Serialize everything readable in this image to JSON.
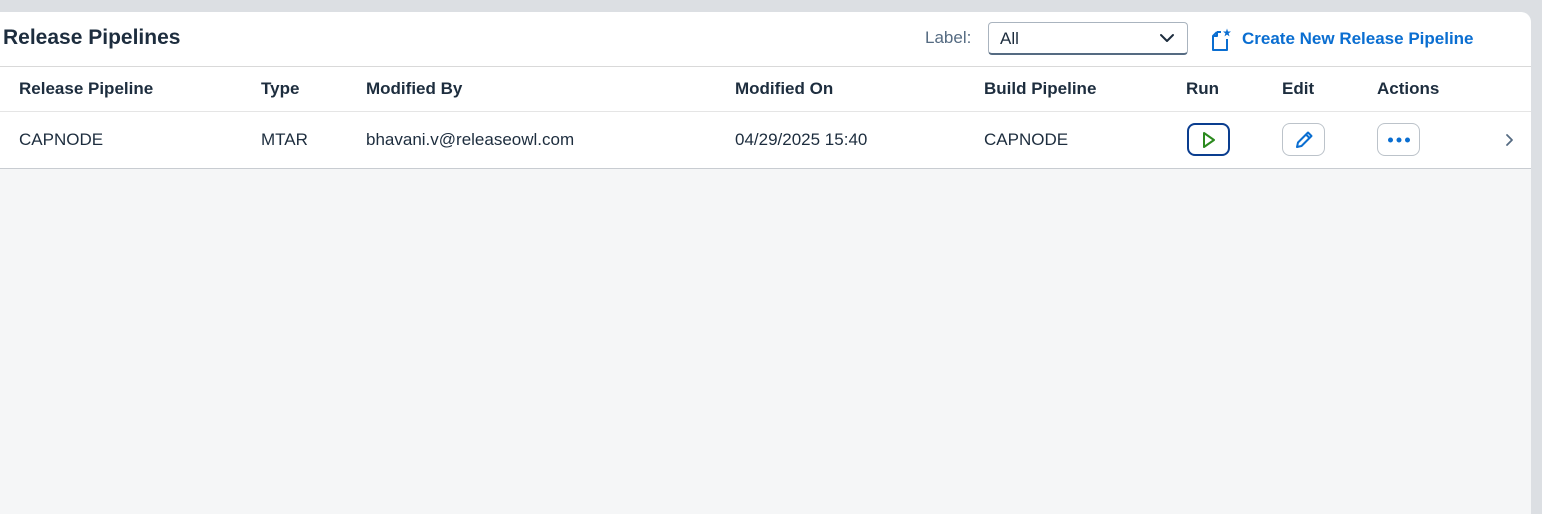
{
  "toolbar": {
    "title": "Release Pipelines",
    "label_text": "Label:",
    "label_select": {
      "value": "All"
    },
    "create_label": "Create New Release Pipeline"
  },
  "table": {
    "columns": [
      "Release Pipeline",
      "Type",
      "Modified By",
      "Modified On",
      "Build Pipeline",
      "Run",
      "Edit",
      "Actions"
    ],
    "rows": [
      {
        "release_pipeline": "CAPNODE",
        "type": "MTAR",
        "modified_by": "bhavani.v@releaseowl.com",
        "modified_on": "04/29/2025 15:40",
        "build_pipeline": "CAPNODE"
      }
    ]
  },
  "icons": {
    "select": "chevron-down-icon",
    "create": "create-document-icon",
    "run": "play-icon",
    "edit": "pencil-icon",
    "actions": "more-horizontal-icon",
    "row_nav": "chevron-right-icon"
  },
  "colors": {
    "accent": "#0a6ed1",
    "run_border": "#0a3d8f",
    "run_icon": "#2b8a1e",
    "text": "#1d2d3e",
    "muted": "#556b82",
    "background": "#f5f6f7"
  }
}
